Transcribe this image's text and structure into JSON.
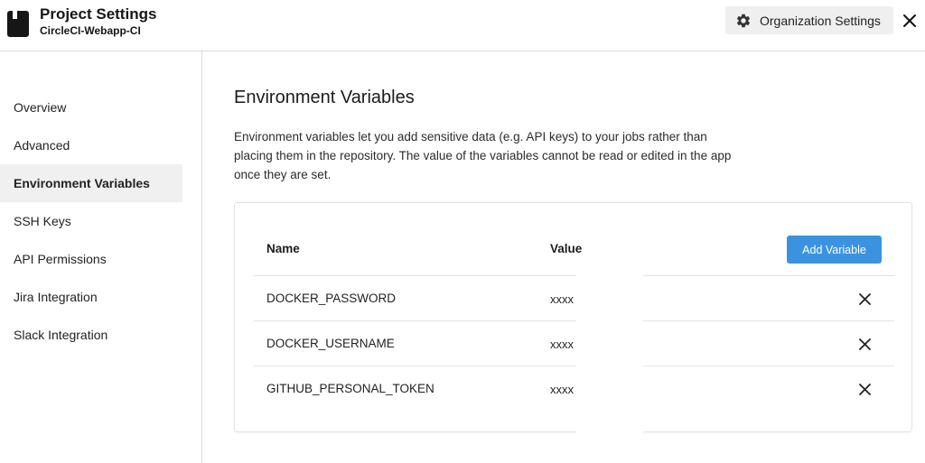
{
  "header": {
    "title": "Project Settings",
    "subtitle": "CircleCI-Webapp-CI",
    "org_button_label": "Organization Settings",
    "org_button_icon": "gear-icon",
    "close_icon": "close-icon"
  },
  "sidebar": {
    "items": [
      {
        "label": "Overview",
        "active": false
      },
      {
        "label": "Advanced",
        "active": false
      },
      {
        "label": "Environment Variables",
        "active": true
      },
      {
        "label": "SSH Keys",
        "active": false
      },
      {
        "label": "API Permissions",
        "active": false
      },
      {
        "label": "Jira Integration",
        "active": false
      },
      {
        "label": "Slack Integration",
        "active": false
      }
    ]
  },
  "main": {
    "title": "Environment Variables",
    "description": "Environment variables let you add sensitive data (e.g. API keys) to your jobs rather than placing them in the repository. The value of the variables cannot be read or edited in the app once they are set.",
    "table": {
      "col_name": "Name",
      "col_value": "Value",
      "add_button": "Add Variable",
      "rows": [
        {
          "name": "DOCKER_PASSWORD",
          "value": "xxxx"
        },
        {
          "name": "DOCKER_USERNAME",
          "value": "xxxx"
        },
        {
          "name": "GITHUB_PERSONAL_TOKEN",
          "value": "xxxx"
        }
      ]
    }
  },
  "colors": {
    "accent": "#3b93e0",
    "active_nav_bg": "#f0f0f0",
    "border": "#dcdcdc"
  }
}
